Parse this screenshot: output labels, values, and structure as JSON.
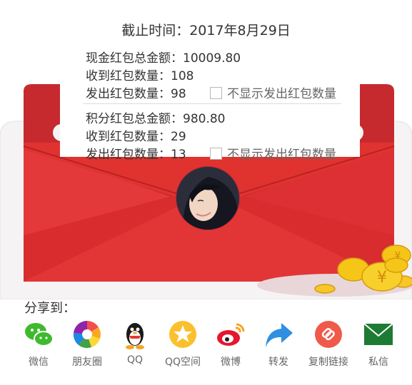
{
  "header": {
    "deadline": "截止时间：2017年8月29日"
  },
  "cash_section": {
    "total_label": "现金红包总金额：",
    "total_value": "10009.80",
    "received_label": "收到红包数量：",
    "received_value": "108",
    "sent_label": "发出红包数量：",
    "sent_value": "98",
    "hide_option": "不显示发出红包数量"
  },
  "points_section": {
    "total_label": "积分红包总金额：",
    "total_value": "980.80",
    "received_label": "收到红包数量：",
    "received_value": "29",
    "sent_label": "发出红包数量：",
    "sent_value": "13",
    "hide_option": "不显示发出红包数量"
  },
  "colors": {
    "envelope_red": "#e0332f",
    "envelope_dark": "#c62a2e",
    "coin_gold": "#f5c518"
  },
  "share": {
    "label": "分享到：",
    "items": [
      {
        "label": "微信",
        "icon": "wechat-icon"
      },
      {
        "label": "朋友圈",
        "icon": "moments-icon"
      },
      {
        "label": "QQ",
        "icon": "qq-icon"
      },
      {
        "label": "QQ空间",
        "icon": "qzone-icon"
      },
      {
        "label": "微博",
        "icon": "weibo-icon"
      },
      {
        "label": "转发",
        "icon": "forward-icon"
      },
      {
        "label": "复制链接",
        "icon": "link-icon"
      },
      {
        "label": "私信",
        "icon": "mail-icon"
      }
    ]
  }
}
